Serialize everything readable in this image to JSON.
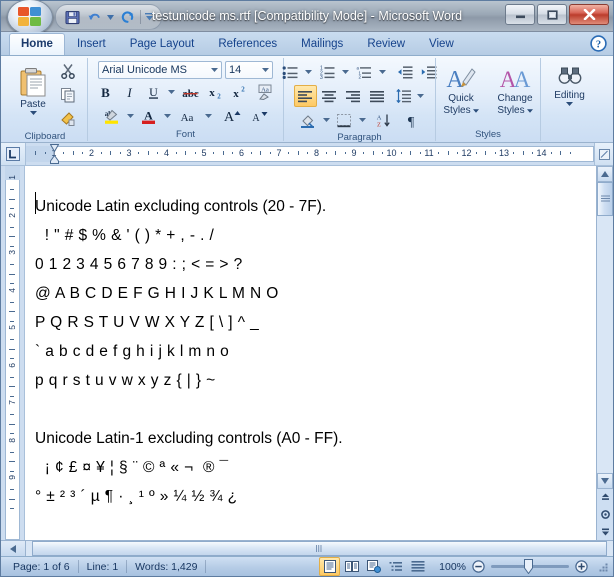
{
  "window": {
    "title": "testunicode ms.rtf [Compatibility Mode] - Microsoft Word",
    "minimize_label": "Minimize",
    "restore_label": "Restore Down",
    "close_label": "Close"
  },
  "quick_access": {
    "office_button": "Office Button",
    "items": [
      {
        "name": "save-icon",
        "label": "Save"
      },
      {
        "name": "undo-icon",
        "label": "Undo"
      },
      {
        "name": "undo-dropdown-icon",
        "label": "Undo History"
      },
      {
        "name": "redo-icon",
        "label": "Repeat Typing"
      },
      {
        "name": "customize-qat-icon",
        "label": "Customize Quick Access Toolbar"
      }
    ]
  },
  "ribbon": {
    "tabs": [
      {
        "label": "Home",
        "active": true
      },
      {
        "label": "Insert",
        "active": false
      },
      {
        "label": "Page Layout",
        "active": false
      },
      {
        "label": "References",
        "active": false
      },
      {
        "label": "Mailings",
        "active": false
      },
      {
        "label": "Review",
        "active": false
      },
      {
        "label": "View",
        "active": false
      }
    ],
    "help_label": "Microsoft Office Word Help",
    "groups": [
      {
        "label": "Clipboard",
        "paste_label": "Paste",
        "buttons": [
          {
            "name": "cut-icon",
            "label": "Cut"
          },
          {
            "name": "copy-icon",
            "label": "Copy"
          },
          {
            "name": "format-painter-icon",
            "label": "Format Painter"
          }
        ],
        "dialog_launcher": "Clipboard dialog launcher"
      },
      {
        "label": "Font",
        "font_name": "Arial Unicode MS",
        "font_size": "14",
        "buttons": [
          {
            "name": "bold-icon",
            "label": "Bold"
          },
          {
            "name": "italic-icon",
            "label": "Italic"
          },
          {
            "name": "underline-icon",
            "label": "Underline"
          },
          {
            "name": "strikethrough-icon",
            "label": "Strikethrough"
          },
          {
            "name": "subscript-icon",
            "label": "Subscript"
          },
          {
            "name": "superscript-icon",
            "label": "Superscript"
          },
          {
            "name": "clear-formatting-icon",
            "label": "Clear Formatting"
          },
          {
            "name": "text-highlight-icon",
            "label": "Text Highlight Color"
          },
          {
            "name": "font-color-icon",
            "label": "Font Color"
          },
          {
            "name": "change-case-icon",
            "label": "Change Case"
          },
          {
            "name": "grow-font-icon",
            "label": "Grow Font"
          },
          {
            "name": "shrink-font-icon",
            "label": "Shrink Font"
          }
        ],
        "dialog_launcher": "Font dialog launcher"
      },
      {
        "label": "Paragraph",
        "buttons": [
          {
            "name": "bullets-icon",
            "label": "Bullets"
          },
          {
            "name": "numbering-icon",
            "label": "Numbering"
          },
          {
            "name": "multilevel-list-icon",
            "label": "Multilevel List"
          },
          {
            "name": "decrease-indent-icon",
            "label": "Decrease Indent"
          },
          {
            "name": "increase-indent-icon",
            "label": "Increase Indent"
          },
          {
            "name": "align-left-icon",
            "label": "Align Text Left"
          },
          {
            "name": "align-center-icon",
            "label": "Center"
          },
          {
            "name": "align-right-icon",
            "label": "Align Text Right"
          },
          {
            "name": "justify-icon",
            "label": "Justify"
          },
          {
            "name": "line-spacing-icon",
            "label": "Line Spacing"
          },
          {
            "name": "shading-icon",
            "label": "Shading"
          },
          {
            "name": "borders-icon",
            "label": "Borders"
          },
          {
            "name": "sort-icon",
            "label": "Sort"
          },
          {
            "name": "show-formatting-marks-icon",
            "label": "Show/Hide Paragraph Marks"
          }
        ],
        "dialog_launcher": "Paragraph dialog launcher"
      },
      {
        "label": "Styles",
        "quick_styles_label": "Quick\nStyles",
        "quick_styles_line1": "Quick",
        "quick_styles_line2": "Styles",
        "change_styles_line1": "Change",
        "change_styles_line2": "Styles",
        "dialog_launcher": "Styles dialog launcher"
      },
      {
        "label": "Editing",
        "editing_label": "Editing"
      }
    ]
  },
  "ruler": {
    "tab_selector": "Left Tab",
    "horizontal_ticks": [
      "1",
      "2",
      "3",
      "4",
      "5",
      "6",
      "7",
      "8",
      "9",
      "10",
      "11",
      "12",
      "13",
      "14"
    ],
    "vertical_ticks": [
      "1",
      "2",
      "3",
      "4",
      "5",
      "6",
      "7",
      "8",
      "9"
    ],
    "left_indent_marker": "First Line Indent",
    "hanging_indent_marker": "Hanging Indent",
    "view_ruler_button": "View Ruler"
  },
  "document": {
    "lines": [
      {
        "text": "Unicode Latin excluding controls (20 - 7F).",
        "style": "head"
      },
      {
        "text": " ! \" # $ % & ' ( ) * + , - . /",
        "style": "ind"
      },
      {
        "text": "0 1 2 3 4 5 6 7 8 9 : ; < = > ?",
        "style": "norm"
      },
      {
        "text": "@ A B C D E F G H I J K L M N O",
        "style": "norm"
      },
      {
        "text": "P Q R S T U V W X Y Z [ \\ ] ^ _",
        "style": "norm"
      },
      {
        "text": "` a b c d e f g h i j k l m n o",
        "style": "norm"
      },
      {
        "text": "p q r s t u v w x y z { | } ~",
        "style": "norm"
      },
      {
        "text": "",
        "style": "blank"
      },
      {
        "text": "Unicode Latin-1 excluding controls (A0 - FF).",
        "style": "head"
      },
      {
        "text": " ¡ ¢ £ ¤ ¥ ¦ § ¨ © ª « ¬ ­ ® ¯",
        "style": "ind"
      },
      {
        "text": "° ± ² ³ ´ µ ¶ · ¸ ¹ º » ¼ ½ ¾ ¿",
        "style": "norm"
      }
    ]
  },
  "scrollbars": {
    "vertical_up": "Line Up",
    "vertical_down": "Line Down",
    "horizontal_left": "Scroll Left",
    "horizontal_right": "Scroll Right",
    "previous_page": "Previous Page",
    "select_browse_object": "Select Browse Object",
    "next_page": "Next Page"
  },
  "status_bar": {
    "page": "Page: 1 of 6",
    "line": "Line: 1",
    "words": "Words: 1,429",
    "views": [
      {
        "name": "print-layout-view-icon",
        "label": "Print Layout",
        "active": true
      },
      {
        "name": "full-screen-reading-view-icon",
        "label": "Full Screen Reading",
        "active": false
      },
      {
        "name": "web-layout-view-icon",
        "label": "Web Layout",
        "active": false
      },
      {
        "name": "outline-view-icon",
        "label": "Outline",
        "active": false
      },
      {
        "name": "draft-view-icon",
        "label": "Draft",
        "active": false
      }
    ],
    "zoom": "100%",
    "zoom_out_label": "Zoom Out",
    "zoom_in_label": "Zoom In",
    "resize_grip": "Resize"
  }
}
